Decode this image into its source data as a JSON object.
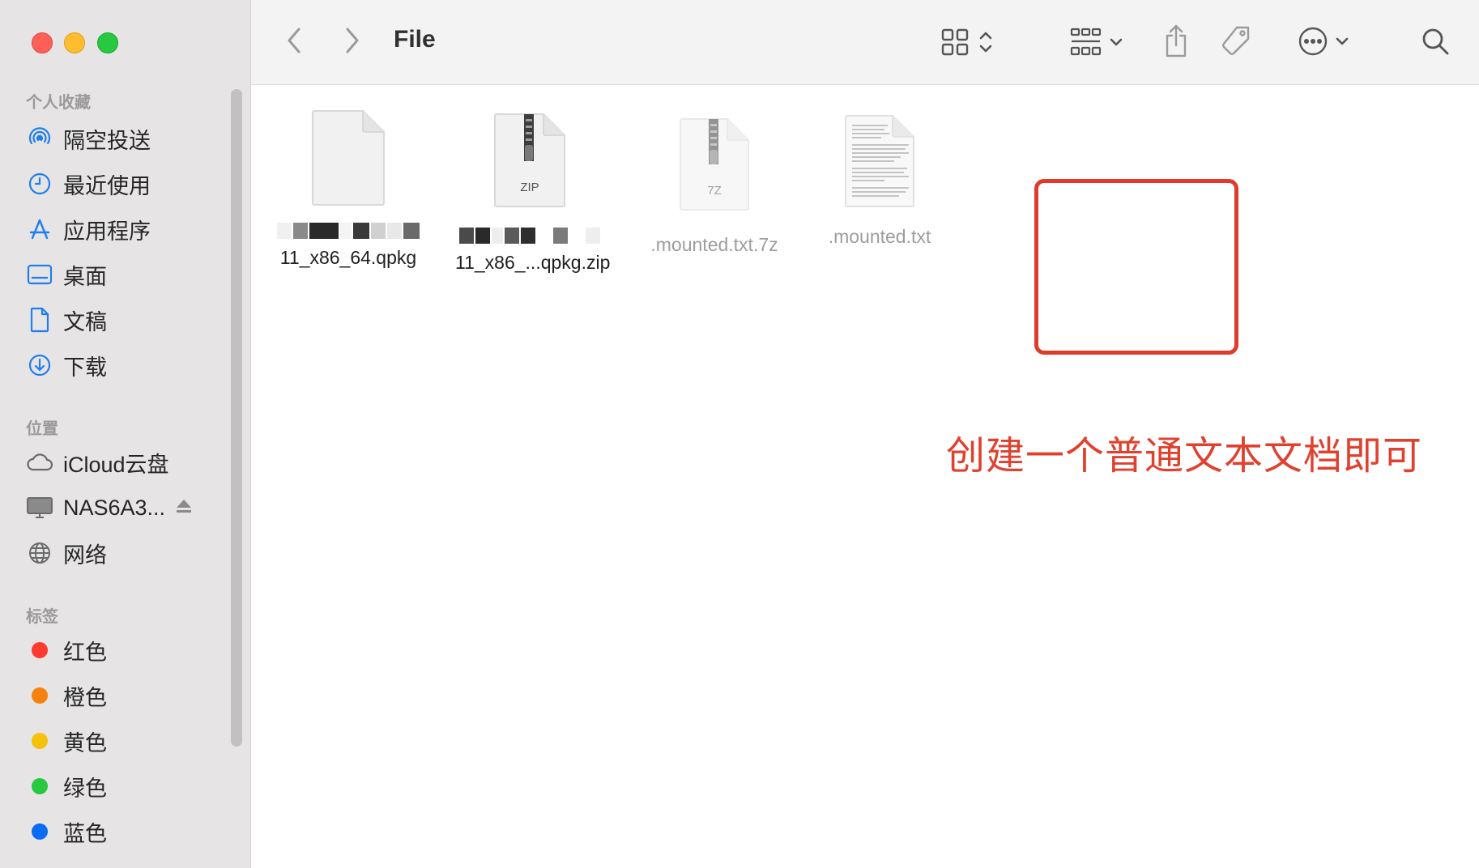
{
  "window": {
    "title": "File"
  },
  "sidebar": {
    "favorites_header": "个人收藏",
    "favorites": [
      {
        "label": "隔空投送",
        "icon": "airdrop-icon"
      },
      {
        "label": "最近使用",
        "icon": "clock-icon"
      },
      {
        "label": "应用程序",
        "icon": "applications-icon"
      },
      {
        "label": "桌面",
        "icon": "desktop-icon"
      },
      {
        "label": "文稿",
        "icon": "document-icon"
      },
      {
        "label": "下载",
        "icon": "download-icon"
      }
    ],
    "locations_header": "位置",
    "locations": [
      {
        "label": "iCloud云盘",
        "icon": "cloud-icon"
      },
      {
        "label": "NAS6A3...",
        "icon": "monitor-icon"
      },
      {
        "label": "网络",
        "icon": "globe-icon"
      }
    ],
    "tags_header": "标签",
    "tags": [
      {
        "label": "红色",
        "color": "#fe3b30"
      },
      {
        "label": "橙色",
        "color": "#f5820e"
      },
      {
        "label": "黄色",
        "color": "#f5c10b"
      },
      {
        "label": "绿色",
        "color": "#28c840"
      },
      {
        "label": "蓝色",
        "color": "#0a6cf5"
      }
    ]
  },
  "files": [
    {
      "name": "11_x86_64.qpkg",
      "type": "generic"
    },
    {
      "name": "11_x86_...qpkg.zip",
      "type": "zip",
      "badge": "ZIP"
    },
    {
      "name": ".mounted.txt.7z",
      "type": "7z",
      "badge": "7Z"
    },
    {
      "name": ".mounted.txt",
      "type": "text"
    }
  ],
  "annotation": {
    "text": "创建一个普通文本文档即可",
    "color": "#e0412f"
  }
}
